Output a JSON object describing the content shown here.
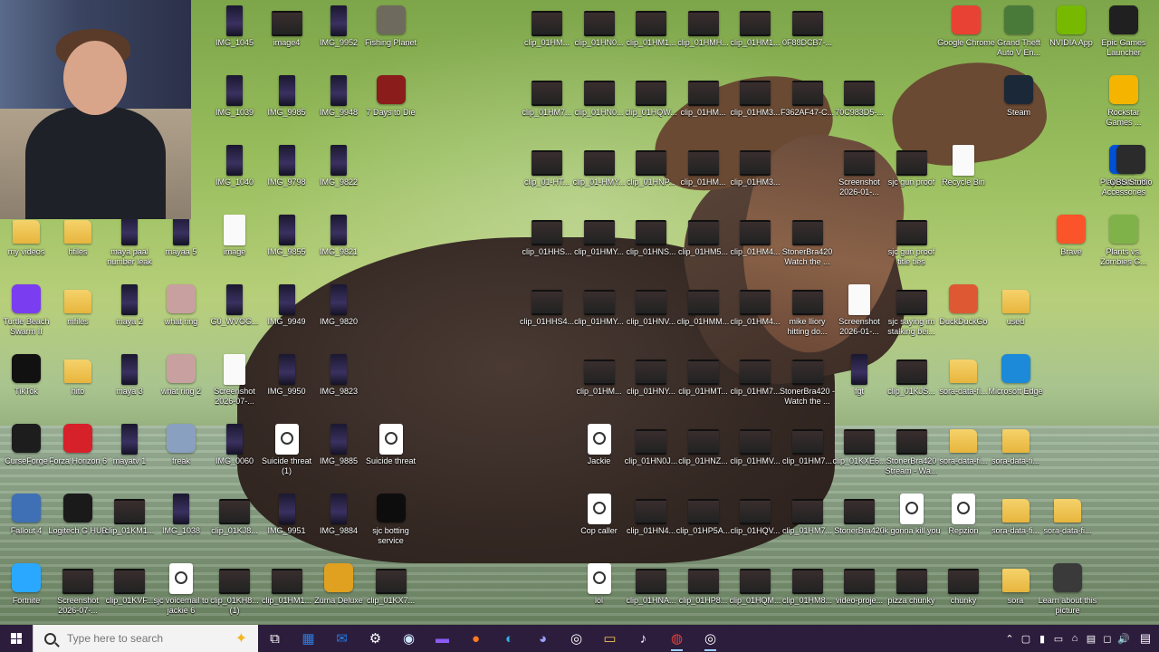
{
  "colors": {
    "taskbar": "#2d1d3d",
    "wallpaper_green": "#8fb35a"
  },
  "taskbar": {
    "search_placeholder": "Type here to search",
    "start_icon": "windows-logo-icon",
    "pinned": [
      {
        "name": "task-view",
        "glyph": "⧉",
        "color": "#ffffff"
      },
      {
        "name": "microsoft-store",
        "glyph": "▦",
        "color": "#2b7de1"
      },
      {
        "name": "outlook",
        "glyph": "✉",
        "color": "#1f7be0"
      },
      {
        "name": "settings",
        "glyph": "⚙",
        "color": "#ffffff"
      },
      {
        "name": "steam",
        "glyph": "◉",
        "color": "#cfe6ff"
      },
      {
        "name": "app-purple",
        "glyph": "▬",
        "color": "#8a5cf5"
      },
      {
        "name": "firefox",
        "glyph": "●",
        "color": "#ff7a20"
      },
      {
        "name": "edge",
        "glyph": "◐",
        "color": "#2fb2e0"
      },
      {
        "name": "discord",
        "glyph": "◕",
        "color": "#9aa3ff"
      },
      {
        "name": "obs",
        "glyph": "◎",
        "color": "#ffffff"
      },
      {
        "name": "file-explorer",
        "glyph": "▭",
        "color": "#f3c54a"
      },
      {
        "name": "tiktok",
        "glyph": "♪",
        "color": "#ffffff"
      },
      {
        "name": "chrome",
        "glyph": "◍",
        "color": "#e84235",
        "active": true
      },
      {
        "name": "obs-2",
        "glyph": "◎",
        "color": "#ffffff",
        "active": true
      }
    ],
    "tray": [
      "⌃",
      "▢",
      "▮",
      "▭",
      "⌂",
      "▤",
      "◻",
      "🔊"
    ],
    "notification": "▤"
  },
  "desktop": {
    "icons": [
      {
        "label": "IMG_1045",
        "type": "phone",
        "col": 0,
        "row": 0
      },
      {
        "label": "image4",
        "type": "video",
        "col": 1,
        "row": 0
      },
      {
        "label": "IMG_9952",
        "type": "phone",
        "col": 2,
        "row": 0
      },
      {
        "label": "Fishing Planet",
        "type": "app",
        "color": "#6f6a5e",
        "col": 3,
        "row": 0
      },
      {
        "label": "clip_01HM...",
        "type": "video",
        "col": 4,
        "row": 0
      },
      {
        "label": "clip_01HN0...",
        "type": "video",
        "col": 5,
        "row": 0
      },
      {
        "label": "clip_01HM1...",
        "type": "video",
        "col": 6,
        "row": 0
      },
      {
        "label": "clip_01HMH...",
        "type": "video",
        "col": 7,
        "row": 0
      },
      {
        "label": "clip_01HM1...",
        "type": "video",
        "col": 8,
        "row": 0
      },
      {
        "label": "0F88DCB7-...",
        "type": "video",
        "col": 9,
        "row": 0
      },
      {
        "label": "Google Chrome",
        "type": "app",
        "color": "#e84235",
        "col": 10,
        "row": 0
      },
      {
        "label": "Grand Theft Auto V En...",
        "type": "app",
        "color": "#4a7a3a",
        "col": 11,
        "row": 0
      },
      {
        "label": "NVIDIA App",
        "type": "app",
        "color": "#76b900",
        "col": 12,
        "row": 0
      },
      {
        "label": "Epic Games Launcher",
        "type": "app",
        "color": "#202020",
        "col": 13,
        "row": 0
      },
      {
        "label": "IMG_1039",
        "type": "phone",
        "col": 0,
        "row": 1
      },
      {
        "label": "IMG_9985",
        "type": "phone",
        "col": 1,
        "row": 1
      },
      {
        "label": "IMG_9948",
        "type": "phone",
        "col": 2,
        "row": 1
      },
      {
        "label": "7 Days to Die",
        "type": "app",
        "color": "#8a1c1c",
        "col": 3,
        "row": 1
      },
      {
        "label": "clip_01HM7...",
        "type": "video",
        "col": 4,
        "row": 1
      },
      {
        "label": "clip_01HN0...",
        "type": "video",
        "col": 5,
        "row": 1
      },
      {
        "label": "clip_01HQW...",
        "type": "video",
        "col": 6,
        "row": 1
      },
      {
        "label": "clip_01HM...",
        "type": "video",
        "col": 7,
        "row": 1
      },
      {
        "label": "clip_01HM3...",
        "type": "video",
        "col": 8,
        "row": 1
      },
      {
        "label": "F362AF47-C...",
        "type": "video",
        "col": 9,
        "row": 1
      },
      {
        "label": "70C983D5-...",
        "type": "video",
        "col": 10,
        "row": 1
      },
      {
        "label": "Steam",
        "type": "app",
        "color": "#1b2838",
        "col": 11,
        "row": 1
      },
      {
        "label": "Rockstar Games ...",
        "type": "app",
        "color": "#f5b400",
        "col": 13,
        "row": 1
      },
      {
        "label": "IMG_1040",
        "type": "phone",
        "col": 0,
        "row": 2
      },
      {
        "label": "IMG_9798",
        "type": "phone",
        "col": 1,
        "row": 2
      },
      {
        "label": "IMG_9822",
        "type": "phone",
        "col": 2,
        "row": 2
      },
      {
        "label": "clip_01-HT...",
        "type": "video",
        "col": 4,
        "row": 2
      },
      {
        "label": "clip_01-HMY...",
        "type": "video",
        "col": 5,
        "row": 2
      },
      {
        "label": "clip_01HNP...",
        "type": "video",
        "col": 6,
        "row": 2
      },
      {
        "label": "clip_01HM...",
        "type": "video",
        "col": 7,
        "row": 2
      },
      {
        "label": "clip_01HM3...",
        "type": "video",
        "col": 8,
        "row": 2
      },
      {
        "label": "Screenshot 2026-01-...",
        "type": "video",
        "col": 10,
        "row": 2
      },
      {
        "label": "sjc gun proof",
        "type": "video",
        "col": 11,
        "row": 2
      },
      {
        "label": "Recycle Bin",
        "type": "doc",
        "col": 12,
        "row": 2
      },
      {
        "label": "PlayStation® Accessories",
        "type": "app",
        "color": "#0050d6",
        "col": 13,
        "row": 2
      },
      {
        "label": "OBS Studio",
        "type": "app",
        "color": "#2b2b2b",
        "col": 14,
        "row": 2
      },
      {
        "label": "my videos",
        "type": "folder",
        "col": -4,
        "row": 3
      },
      {
        "label": "hfiles",
        "type": "folder",
        "col": -3,
        "row": 3
      },
      {
        "label": "maya paal number leak",
        "type": "phone",
        "col": -2,
        "row": 3
      },
      {
        "label": "mayaa 5",
        "type": "phone",
        "col": -1,
        "row": 3
      },
      {
        "label": "image",
        "type": "doc",
        "col": 0,
        "row": 3
      },
      {
        "label": "IMG_9855",
        "type": "phone",
        "col": 1,
        "row": 3
      },
      {
        "label": "IMG_9821",
        "type": "phone",
        "col": 2,
        "row": 3
      },
      {
        "label": "clip_01HHS...",
        "type": "video",
        "col": 4,
        "row": 3
      },
      {
        "label": "clip_01HMY...",
        "type": "video",
        "col": 5,
        "row": 3
      },
      {
        "label": "clip_01HNS...",
        "type": "video",
        "col": 6,
        "row": 3
      },
      {
        "label": "clip_01HM5...",
        "type": "video",
        "col": 7,
        "row": 3
      },
      {
        "label": "clip_01HM4...",
        "type": "video",
        "col": 8,
        "row": 3
      },
      {
        "label": "StonerBra420 Watch the ...",
        "type": "video",
        "col": 9,
        "row": 3
      },
      {
        "label": "sjc gun proof title ties",
        "type": "video",
        "col": 11,
        "row": 3
      },
      {
        "label": "Brave",
        "type": "app",
        "color": "#fb542b",
        "col": 12,
        "row": 3
      },
      {
        "label": "Plants vs. Zombies G...",
        "type": "app",
        "color": "#7fb34a",
        "col": 13,
        "row": 3
      },
      {
        "label": "Turtle Beach Swarm II",
        "type": "app",
        "color": "#7b3df0",
        "col": -4,
        "row": 4
      },
      {
        "label": "mfiles",
        "type": "folder",
        "col": -3,
        "row": 4
      },
      {
        "label": "maya 2",
        "type": "phone",
        "col": -2,
        "row": 4
      },
      {
        "label": "what ring",
        "type": "app",
        "color": "#c9a0a0",
        "col": -1,
        "row": 4
      },
      {
        "label": "G0_WVOG...",
        "type": "phone",
        "col": 0,
        "row": 4
      },
      {
        "label": "IMG_9949",
        "type": "phone",
        "col": 1,
        "row": 4
      },
      {
        "label": "IMG_9820",
        "type": "phone",
        "col": 2,
        "row": 4
      },
      {
        "label": "clip_01HHS4...",
        "type": "video",
        "col": 4,
        "row": 4
      },
      {
        "label": "clip_01HMY...",
        "type": "video",
        "col": 5,
        "row": 4
      },
      {
        "label": "clip_01HNV...",
        "type": "video",
        "col": 6,
        "row": 4
      },
      {
        "label": "clip_01HMM...",
        "type": "video",
        "col": 7,
        "row": 4
      },
      {
        "label": "clip_01HM4...",
        "type": "video",
        "col": 8,
        "row": 4
      },
      {
        "label": "mike lliory hitting do...",
        "type": "video",
        "col": 9,
        "row": 4
      },
      {
        "label": "Screenshot 2026-01-...",
        "type": "doc",
        "col": 10,
        "row": 4
      },
      {
        "label": "sjc saying im stalking bei...",
        "type": "video",
        "col": 11,
        "row": 4
      },
      {
        "label": "DuckDuckGo",
        "type": "app",
        "color": "#de5833",
        "col": 12,
        "row": 4
      },
      {
        "label": "used",
        "type": "folder",
        "col": 13,
        "row": 4
      },
      {
        "label": "TikTok",
        "type": "app",
        "color": "#111111",
        "col": -4,
        "row": 5
      },
      {
        "label": "hito",
        "type": "folder",
        "col": -3,
        "row": 5
      },
      {
        "label": "maya 3",
        "type": "phone",
        "col": -2,
        "row": 5
      },
      {
        "label": "what ring 2",
        "type": "app",
        "color": "#c9a0a0",
        "col": -1,
        "row": 5
      },
      {
        "label": "Screenshot 2026-07-...",
        "type": "doc",
        "col": 0,
        "row": 5
      },
      {
        "label": "IMG_9950",
        "type": "phone",
        "col": 1,
        "row": 5
      },
      {
        "label": "IMG_9823",
        "type": "phone",
        "col": 2,
        "row": 5
      },
      {
        "label": "clip_01HM...",
        "type": "video",
        "col": 5,
        "row": 5
      },
      {
        "label": "clip_01HNY...",
        "type": "video",
        "col": 6,
        "row": 5
      },
      {
        "label": "clip_01HMT...",
        "type": "video",
        "col": 7,
        "row": 5
      },
      {
        "label": "clip_01HM7...",
        "type": "video",
        "col": 8,
        "row": 5
      },
      {
        "label": "StonerBra420 - Watch the ...",
        "type": "video",
        "col": 9,
        "row": 5
      },
      {
        "label": "fgt",
        "type": "phone",
        "col": 10,
        "row": 5
      },
      {
        "label": "clip_01KJS...",
        "type": "video",
        "col": 11,
        "row": 5
      },
      {
        "label": "sora-data-fi...",
        "type": "folder",
        "col": 12,
        "row": 5
      },
      {
        "label": "Microsoft Edge",
        "type": "app",
        "color": "#1c8ad8",
        "col": 13,
        "row": 5
      },
      {
        "label": "CurseForge",
        "type": "app",
        "color": "#1d1d1d",
        "col": -4,
        "row": 6
      },
      {
        "label": "Forza Horizon 6",
        "type": "app",
        "color": "#d6202a",
        "col": -3,
        "row": 6
      },
      {
        "label": "mayatv 1",
        "type": "phone",
        "col": -2,
        "row": 6
      },
      {
        "label": "freak",
        "type": "app",
        "color": "#8aa0c0",
        "col": -1,
        "row": 6
      },
      {
        "label": "IMG_0060",
        "type": "phone",
        "col": 0,
        "row": 6
      },
      {
        "label": "Suicide threat (1)",
        "type": "play",
        "col": 1,
        "row": 6
      },
      {
        "label": "IMG_9885",
        "type": "phone",
        "col": 2,
        "row": 6
      },
      {
        "label": "Suicide threat",
        "type": "play",
        "col": 3,
        "row": 6
      },
      {
        "label": "Jackie",
        "type": "play",
        "col": 5,
        "row": 6
      },
      {
        "label": "clip_01HN0J...",
        "type": "video",
        "col": 6,
        "row": 6
      },
      {
        "label": "clip_01HNZ...",
        "type": "video",
        "col": 7,
        "row": 6
      },
      {
        "label": "clip_01HMV...",
        "type": "video",
        "col": 8,
        "row": 6
      },
      {
        "label": "clip_01HM7...",
        "type": "video",
        "col": 9,
        "row": 6
      },
      {
        "label": "clip_01KXE6...",
        "type": "video",
        "col": 10,
        "row": 6
      },
      {
        "label": "StonerBra420 Stream - Wa...",
        "type": "video",
        "col": 11,
        "row": 6
      },
      {
        "label": "sora-data-fi...",
        "type": "folder",
        "col": 12,
        "row": 6
      },
      {
        "label": "sora-data-fi...",
        "type": "folder",
        "col": 13,
        "row": 6
      },
      {
        "label": "Fallout 4",
        "type": "app",
        "color": "#3f6fb5",
        "col": -4,
        "row": 7
      },
      {
        "label": "Logitech G HUB",
        "type": "app",
        "color": "#1a1a1a",
        "col": -3,
        "row": 7
      },
      {
        "label": "clip_01KM1...",
        "type": "video",
        "col": -2,
        "row": 7
      },
      {
        "label": "IMG_1038",
        "type": "phone",
        "col": -1,
        "row": 7
      },
      {
        "label": "clip_01KJ8...",
        "type": "video",
        "col": 0,
        "row": 7
      },
      {
        "label": "IMG_9951",
        "type": "phone",
        "col": 1,
        "row": 7
      },
      {
        "label": "IMG_9884",
        "type": "phone",
        "col": 2,
        "row": 7
      },
      {
        "label": "sjc botting service",
        "type": "app",
        "color": "#0d0d0d",
        "col": 3,
        "row": 7
      },
      {
        "label": "Cop caller",
        "type": "play",
        "col": 5,
        "row": 7
      },
      {
        "label": "clip_01HN4...",
        "type": "video",
        "col": 6,
        "row": 7
      },
      {
        "label": "clip_01HP5A...",
        "type": "video",
        "col": 7,
        "row": 7
      },
      {
        "label": "clip_01HQV...",
        "type": "video",
        "col": 8,
        "row": 7
      },
      {
        "label": "clip_01HM7...",
        "type": "video",
        "col": 9,
        "row": 7
      },
      {
        "label": "StonerBra420",
        "type": "video",
        "col": 10,
        "row": 7
      },
      {
        "label": "ik gonna kill you",
        "type": "play",
        "col": 11,
        "row": 7
      },
      {
        "label": "Repzion",
        "type": "play",
        "col": 12,
        "row": 7
      },
      {
        "label": "sora-data-fi...",
        "type": "folder",
        "col": 13,
        "row": 7
      },
      {
        "label": "sora-data-fi...",
        "type": "folder",
        "col": 14,
        "row": 7
      },
      {
        "label": "Fortnite",
        "type": "app",
        "color": "#2aa8ff",
        "col": -4,
        "row": 8
      },
      {
        "label": "Screenshot 2026-07-...",
        "type": "video",
        "col": -3,
        "row": 8
      },
      {
        "label": "clip_01KVF...",
        "type": "video",
        "col": -2,
        "row": 8
      },
      {
        "label": "sjc voicemail to jackie 6",
        "type": "play",
        "col": -1,
        "row": 8
      },
      {
        "label": "clip_01KH8... (1)",
        "type": "video",
        "col": 0,
        "row": 8
      },
      {
        "label": "clip_01HM1...",
        "type": "video",
        "col": 1,
        "row": 8
      },
      {
        "label": "Zuma Deluxe",
        "type": "app",
        "color": "#e0a020",
        "col": 2,
        "row": 8
      },
      {
        "label": "clip_01KX7...",
        "type": "video",
        "col": 3,
        "row": 8
      },
      {
        "label": "lol",
        "type": "play",
        "col": 5,
        "row": 8
      },
      {
        "label": "clip_01HNA...",
        "type": "video",
        "col": 6,
        "row": 8
      },
      {
        "label": "clip_01HP8...",
        "type": "video",
        "col": 7,
        "row": 8
      },
      {
        "label": "clip_01HQM...",
        "type": "video",
        "col": 8,
        "row": 8
      },
      {
        "label": "clip_01HM8...",
        "type": "video",
        "col": 9,
        "row": 8
      },
      {
        "label": "video-proje...",
        "type": "video",
        "col": 10,
        "row": 8
      },
      {
        "label": "pizza chunky",
        "type": "video",
        "col": 11,
        "row": 8
      },
      {
        "label": "chunky",
        "type": "video",
        "col": 12,
        "row": 8
      },
      {
        "label": "sora",
        "type": "folder",
        "col": 13,
        "row": 8
      },
      {
        "label": "Learn about this picture",
        "type": "app",
        "color": "#3a3a3a",
        "col": 14,
        "row": 8
      }
    ]
  }
}
